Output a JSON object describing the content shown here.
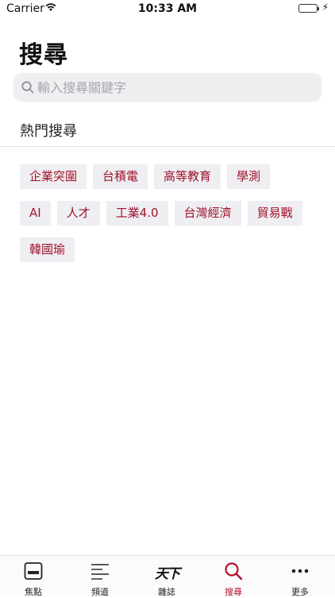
{
  "status_bar": {
    "carrier": "Carrier",
    "time": "10:33 AM",
    "charging_symbol": "⚡"
  },
  "page": {
    "title": "搜尋"
  },
  "search": {
    "placeholder": "輸入搜尋關鍵字",
    "value": ""
  },
  "hot_search": {
    "title": "熱門搜尋",
    "rows": [
      [
        "企業突圍",
        "台積電",
        "高等教育",
        "學測"
      ],
      [
        "AI",
        "人才",
        "工業4.0",
        "台灣經濟",
        "貿易戰"
      ],
      [
        "韓國瑜"
      ]
    ]
  },
  "tabbar": {
    "items": [
      {
        "label": "焦點",
        "icon": "focus-icon"
      },
      {
        "label": "頻道",
        "icon": "channels-menu-icon"
      },
      {
        "label": "雜誌",
        "icon": "magazine-logo-icon",
        "logo_text": "天下"
      },
      {
        "label": "搜尋",
        "icon": "search-icon",
        "active": true
      },
      {
        "label": "更多",
        "icon": "more-icon"
      }
    ]
  },
  "colors": {
    "accent": "#a0122a",
    "tag_bg": "#efeff3",
    "search_bg": "#efeff2",
    "battery": "#4cd964"
  }
}
